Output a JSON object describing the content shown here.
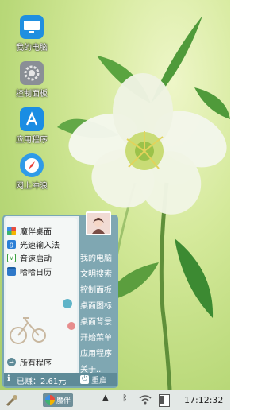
{
  "desktop": {
    "icons": [
      {
        "label": "我的电脑",
        "icon": "monitor-icon"
      },
      {
        "label": "控制面板",
        "icon": "gear-icon"
      },
      {
        "label": "应用程序",
        "icon": "app-store-icon"
      },
      {
        "label": "网上冲浪",
        "icon": "compass-icon"
      }
    ]
  },
  "start_menu": {
    "apps": [
      {
        "label": "魔伴桌面",
        "icon": "pinwheel-icon"
      },
      {
        "label": "光速输入法",
        "icon": "g-input-icon"
      },
      {
        "label": "音速启动",
        "icon": "v-launcher-icon"
      },
      {
        "label": "哈哈日历",
        "icon": "calendar-icon"
      }
    ],
    "all_programs": "所有程序",
    "right_items": [
      "我的电脑",
      "文明搜索",
      "控制面板",
      "桌面图标",
      "桌面背景",
      "开始菜单",
      "应用程序",
      "关于.."
    ],
    "earned": "已赚：2.61元",
    "restart": "重启"
  },
  "taskbar": {
    "start_label": "魔伴",
    "clock": "17:12:32"
  },
  "colors": {
    "menu_border": "#7aa8b4",
    "menu_panel": "#7fa7b2",
    "menu_bottom": "#5f8b98",
    "wallpaper_green": "#b8d878"
  }
}
